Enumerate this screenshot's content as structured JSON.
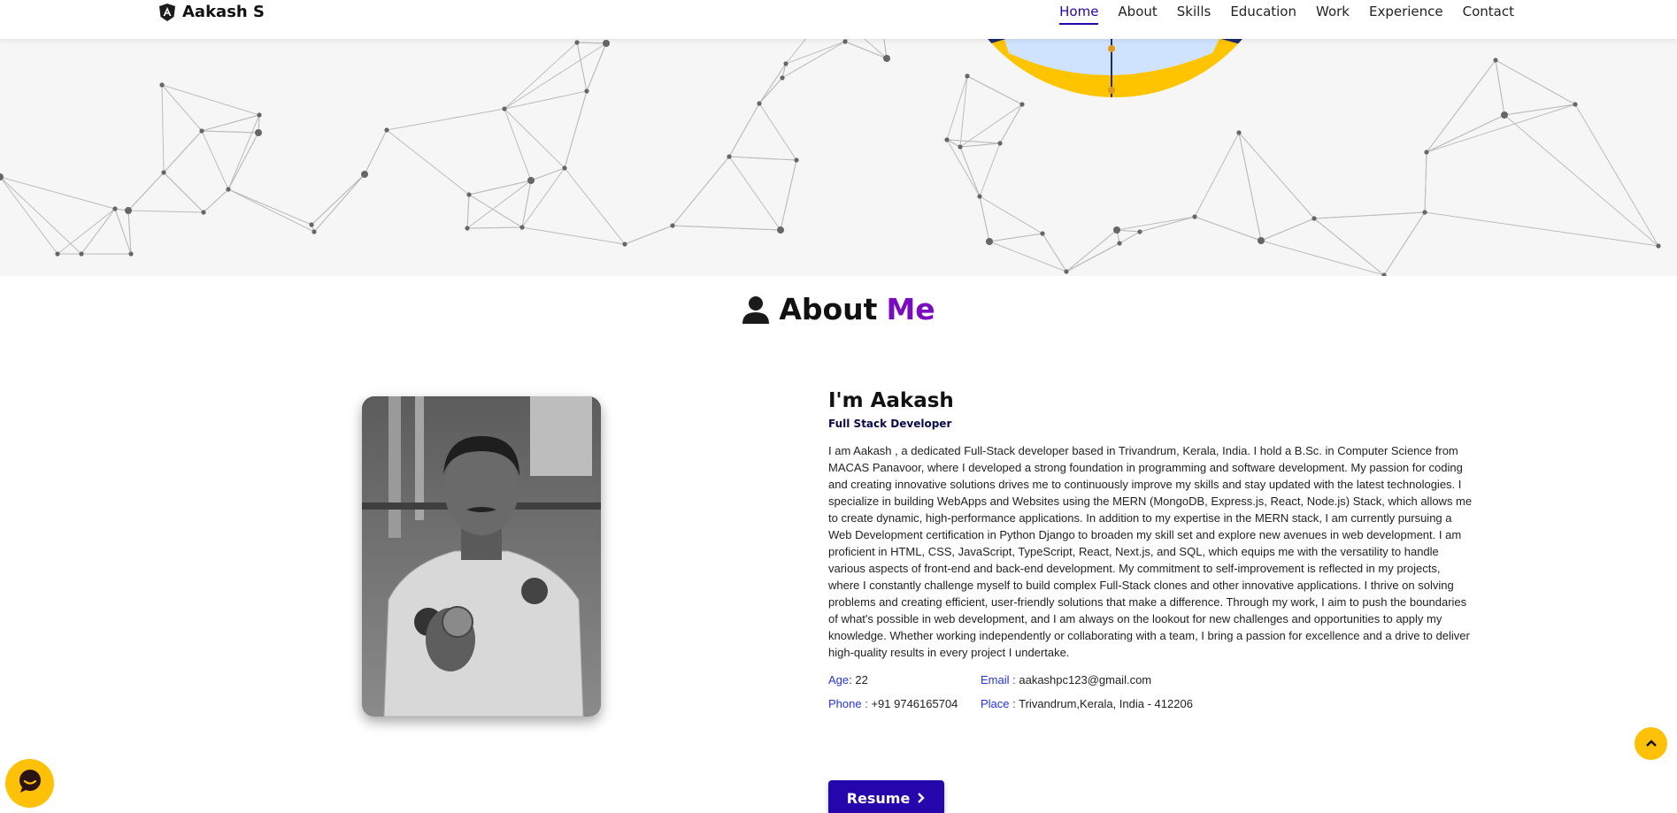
{
  "navbar": {
    "brand": "Aakash S",
    "links": [
      {
        "label": "Home",
        "active": true
      },
      {
        "label": "About"
      },
      {
        "label": "Skills"
      },
      {
        "label": "Education"
      },
      {
        "label": "Work"
      },
      {
        "label": "Experience"
      },
      {
        "label": "Contact"
      }
    ]
  },
  "about": {
    "title_main": "About",
    "title_accent": "Me",
    "name": "I'm Aakash",
    "role": "Full Stack Developer",
    "description": "I am Aakash , a dedicated Full-Stack developer based in Trivandrum, Kerala, India. I hold a B.Sc. in Computer Science from MACAS Panavoor, where I developed a strong foundation in programming and software development. My passion for coding and creating innovative solutions drives me to continuously improve my skills and stay updated with the latest technologies. I specialize in building WebApps and Websites using the MERN (MongoDB, Express.js, React, Node.js) Stack, which allows me to create dynamic, high-performance applications. In addition to my expertise in the MERN stack, I am currently pursuing a Web Development certification in Python Django to broaden my skill set and explore new avenues in web development. I am proficient in HTML, CSS, JavaScript, TypeScript, React, Next.js, and SQL, which equips me with the versatility to handle various aspects of front-end and back-end development. My commitment to self-improvement is reflected in my projects, where I constantly challenge myself to build complex Full-Stack clones and other innovative applications. I thrive on solving problems and creating efficient, user-friendly solutions that make a difference. Through my work, I aim to push the boundaries of what's possible in web development, and I am always on the lookout for new challenges and opportunities to apply my knowledge. Whether working independently or collaborating with a team, I bring a passion for excellence and a drive to deliver high-quality results in every project I undertake.",
    "info": {
      "age_label": "Age",
      "age_value": ": 22",
      "email_label": "Email :",
      "email_value": "aakashpc123@gmail.com",
      "phone_label": "Phone :",
      "phone_value": "+91 9746165704",
      "place_label": "Place :",
      "place_value": "Trivandrum,Kerala, India - 412206"
    },
    "resume_label": "Resume"
  },
  "icons": {
    "brand": "angular-shield-icon",
    "title": "user-icon",
    "chat": "chat-bubble-icon",
    "scroll_top": "chevron-up-icon",
    "resume": "chevron-right-icon"
  },
  "colors": {
    "primary": "#2506ad",
    "accent": "#7a0bc0",
    "label": "#2535e0",
    "float": "#ffc107"
  }
}
